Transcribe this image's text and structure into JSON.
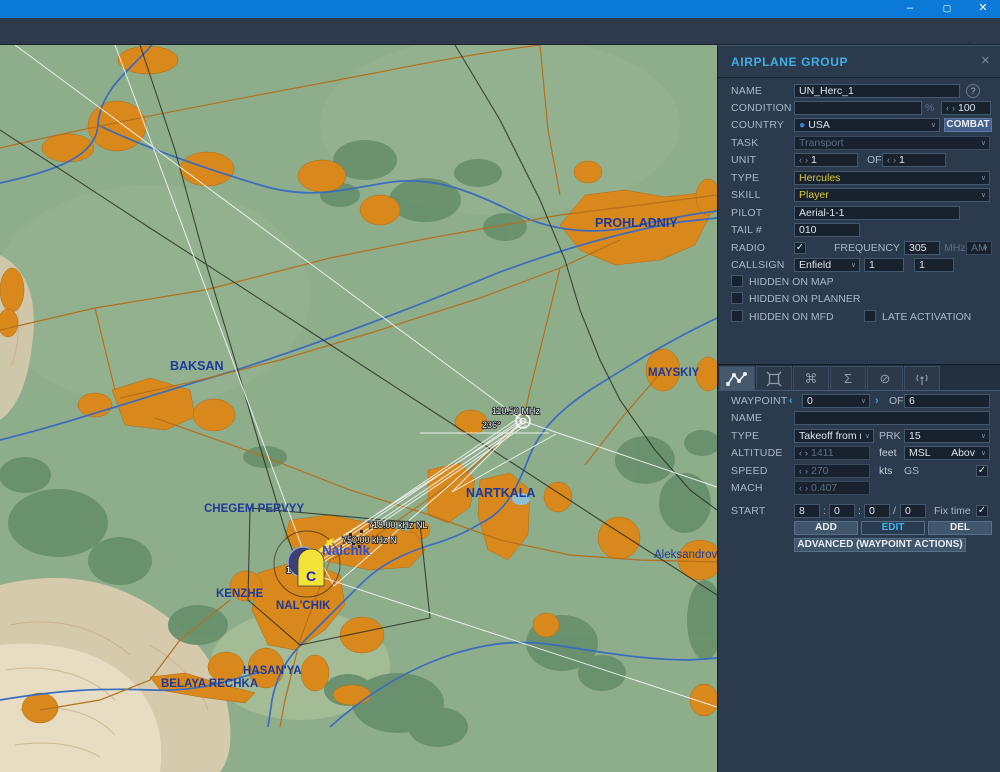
{
  "window": {
    "titlebar": {
      "minimize": "–",
      "maximize": "▢",
      "close": "✕"
    },
    "toolbar": {
      "close": "✕"
    }
  },
  "panel": {
    "title": "AIRPLANE GROUP",
    "close": "✕",
    "name": {
      "label": "NAME",
      "value": "UN_Herc_1",
      "help": "?"
    },
    "condition": {
      "label": "CONDITION",
      "value": "",
      "percent": "%",
      "spin": "100"
    },
    "country": {
      "label": "COUNTRY",
      "value": "USA",
      "combat": "COMBAT"
    },
    "task": {
      "label": "TASK",
      "value": "Transport"
    },
    "unit": {
      "label": "UNIT",
      "count": "1",
      "of": "OF",
      "total": "1"
    },
    "type": {
      "label": "TYPE",
      "value": "Hercules"
    },
    "skill": {
      "label": "SKILL",
      "value": "Player"
    },
    "pilot": {
      "label": "PILOT",
      "value": "Aerial-1-1"
    },
    "tail": {
      "label": "TAIL #",
      "value": "010"
    },
    "radio": {
      "label": "RADIO",
      "check": "✓",
      "freq_label": "FREQUENCY",
      "freq": "305",
      "mhz": "MHz",
      "mod": "AM"
    },
    "callsign": {
      "label": "CALLSIGN",
      "value": "Enfield",
      "n1": "1",
      "n2": "1"
    },
    "hidden_map": "HIDDEN ON MAP",
    "hidden_planner": "HIDDEN ON PLANNER",
    "hidden_mfd": "HIDDEN ON MFD",
    "late_activation": "LATE ACTIVATION",
    "waypoint": {
      "label": "WAYPOINT",
      "index": "0",
      "of": "OF",
      "total": "6",
      "name_label": "NAME",
      "name_value": "",
      "type_label": "TYPE",
      "type_value": "Takeoff from ran",
      "prk_label": "PRK",
      "prk_value": "15",
      "alt_label": "ALTITUDE",
      "alt_value": "1411",
      "alt_unit": "feet",
      "alt_ref": "MSL",
      "alt_ref2": "Abov",
      "speed_label": "SPEED",
      "speed_value": "270",
      "speed_unit": "kts",
      "gs_label": "GS",
      "gs_check": "✓",
      "mach_label": "MACH",
      "mach_value": "0.407",
      "start_label": "START",
      "h": "8",
      "m": "0",
      "s": "0",
      "d": "0",
      "colon": ":",
      "slash": "/",
      "fix_label": "Fix time",
      "fix_check": "✓",
      "add": "ADD",
      "edit": "EDIT",
      "del": "DEL",
      "advanced": "ADVANCED (WAYPOINT ACTIONS)"
    }
  },
  "map": {
    "cities": [
      "PROHLADNIY",
      "BAKSAN",
      "MAYSKIY",
      "NARTKALA",
      "CHEGEM PERVYY",
      "KENZHE",
      "NAL'CHIK",
      "HASAN'YA",
      "BELAYA RECHKA",
      "Aleksandrovskaya",
      "Nalchik"
    ],
    "navaids": [
      "718.00 kHz NL",
      "750.00 kHz N",
      "110.50 MHz",
      "236°"
    ],
    "group_icon": {
      "number": "1",
      "letter": "C"
    }
  }
}
